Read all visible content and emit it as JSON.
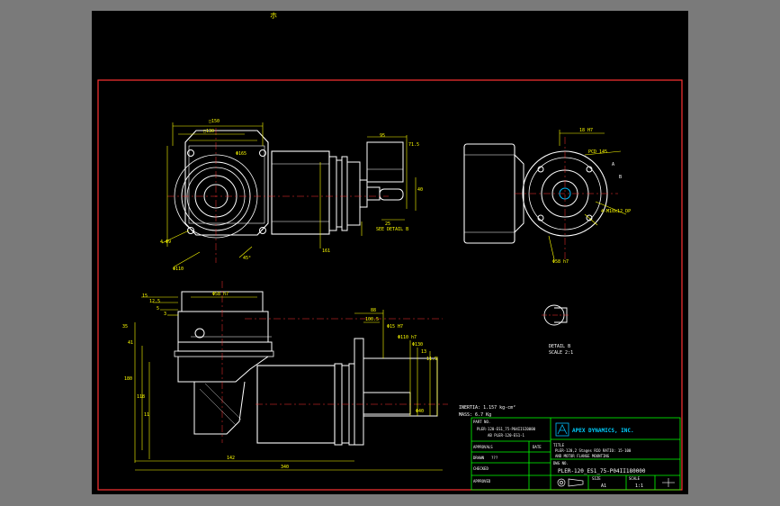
{
  "colors": {
    "background": "#000000",
    "border": "#ff3333",
    "outline": "#ffffff",
    "dimension": "#ffff00",
    "titleblock": "#00ff00",
    "logo": "#00bfff"
  },
  "icons": [
    "compass-mark-icon",
    "logo-icon",
    "projection-symbol-icon"
  ],
  "top_mark": "ホ",
  "dimensions": {
    "front_top_width": "□150",
    "front_flange_inner": "□130",
    "front_bolt_circle": "Φ165",
    "front_body": "Φ110",
    "front_bottom": "4-Φ9",
    "front_angle": "45°",
    "front_height": "161",
    "motor_len_top": "95",
    "motor_len_side": "71.5",
    "motor_w": "40",
    "motor_small": "25",
    "detail_b": "SEE DETAIL B",
    "top_tick": "18 H7",
    "side_pcd": "PCD 145",
    "side_mount": "4-M10x12 DP",
    "side_bore": "Φ58 h7",
    "side_a": "A",
    "side_b": "B",
    "bottom_left_1": "15",
    "bottom_left_2": "12.5",
    "bottom_left_3": "5",
    "bottom_left_4": "3",
    "bottom_h1": "35",
    "bottom_h2": "41",
    "bottom_h3": "180",
    "bottom_h4": "118",
    "bottom_h5": "11",
    "bottom_top": "Φ58 h7",
    "bottom_shaft": "88",
    "bottom_total": "340",
    "bottom_left_total": "142",
    "bottom_right_1": "Φ15 H7",
    "bottom_right_2": "Φ110 h7",
    "bottom_right_3": "Φ130",
    "bottom_right_4": "13",
    "bottom_right_5": "11.5",
    "bottom_right_6": "Φ40",
    "bottom_right_7": "100.5",
    "detail_label": "DETAIL B",
    "detail_scale": "SCALE 2:1"
  },
  "notes": {
    "inertia": "INERTIA: 1.157 kg-cm²",
    "mass": "MASS: 6.7 Kg"
  },
  "titleblock": {
    "part_no_label": "PART NO.",
    "part_no_1": "PLER-120-ES1_75-P04IISI0000",
    "part_no_2": "AB PLER-120-ES1-1",
    "approvals_label": "APPROVALS",
    "date_label": "DATE",
    "drawn_label": "DRAWN",
    "drawn_value": "???",
    "checked_label": "CHECKED",
    "approved_label": "APPROVED",
    "company": "APEX DYNAMICS, INC.",
    "title_label": "TITLE",
    "title_1": "PLER-120,2 Stages RIO  RATIO: 15-100",
    "title_2": "AND MOTOR FLANGE MOUNTING",
    "dwg_label": "DWG NO.",
    "dwg_no": "PLER-120_ES1_75-P04II180000",
    "size_label": "SIZE",
    "size_value": "A1",
    "scale_label": "SCALE",
    "scale_value": "1:1"
  }
}
